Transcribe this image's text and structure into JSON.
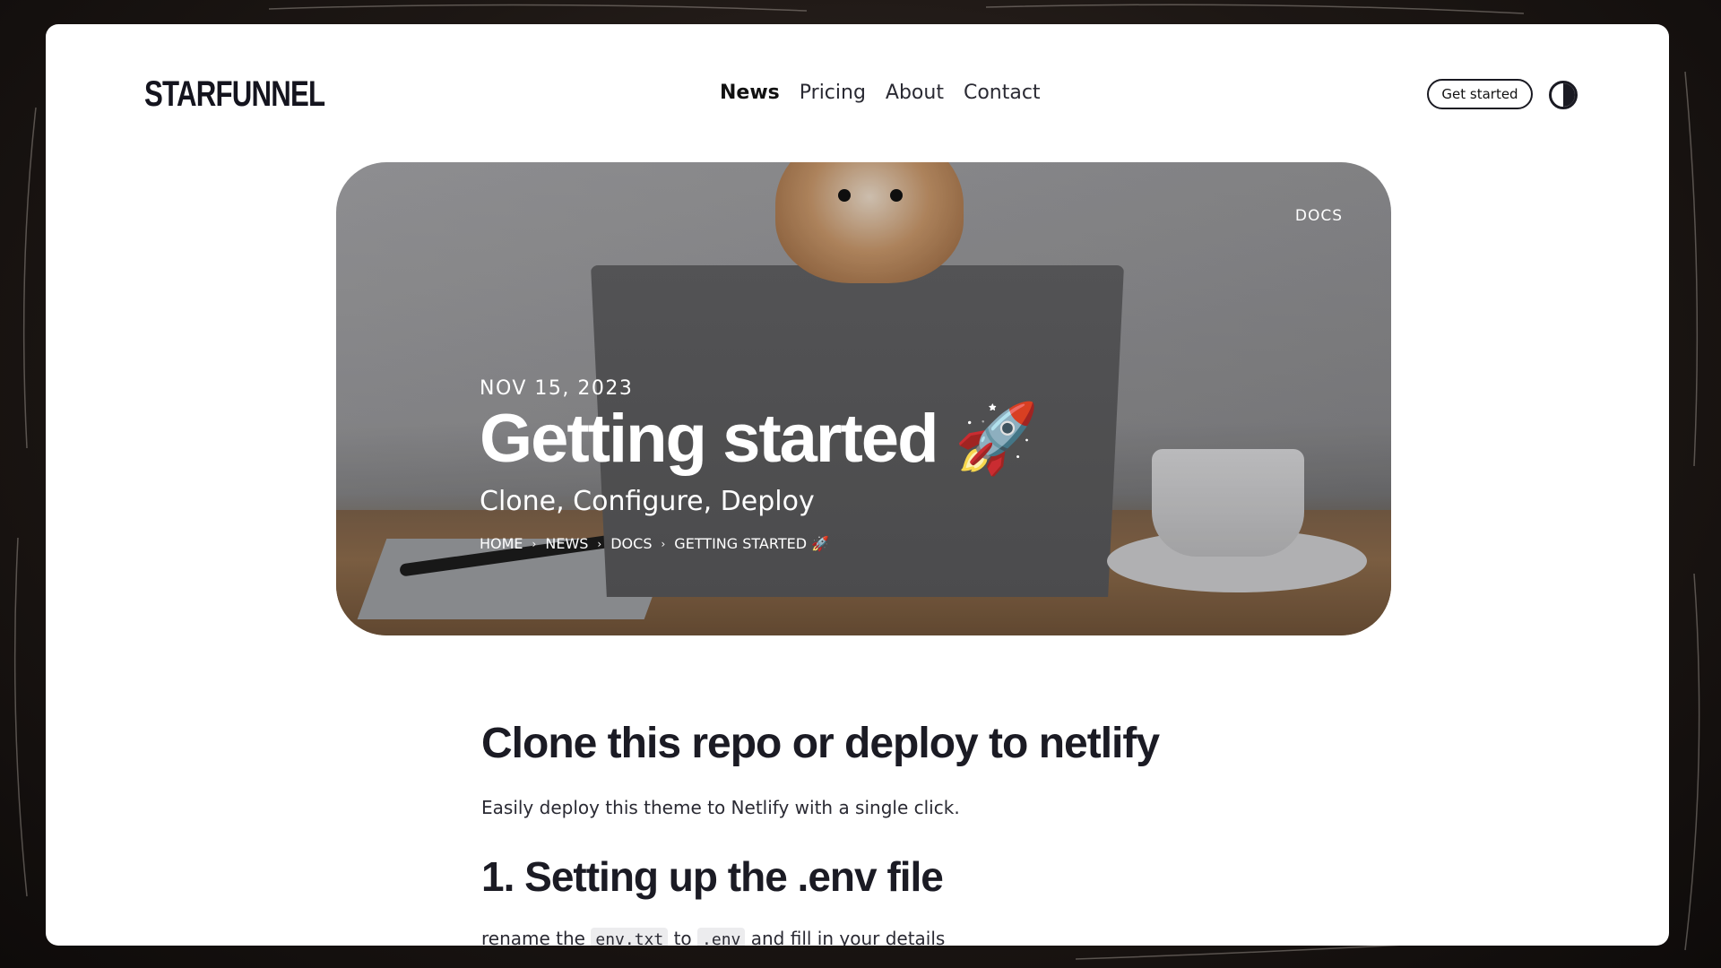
{
  "site": {
    "logo": "STARFUNNEL"
  },
  "nav": {
    "items": [
      "News",
      "Pricing",
      "About",
      "Contact"
    ],
    "active": "News"
  },
  "header": {
    "cta": "Get started",
    "theme_icon": "contrast-icon"
  },
  "hero": {
    "tag": "DOCS",
    "date": "NOV 15, 2023",
    "title": "Getting started 🚀",
    "subtitle": "Clone, Configure, Deploy",
    "breadcrumb": [
      "HOME",
      "NEWS",
      "DOCS",
      "GETTING STARTED 🚀"
    ]
  },
  "article": {
    "h2": "Clone this repo or deploy to netlify",
    "p1": "Easily deploy this theme to Netlify with a single click.",
    "h3": "1. Setting up the .env file",
    "p2_a": "rename the",
    "p2_code1": "env.txt",
    "p2_b": "to",
    "p2_code2": ".env",
    "p2_c": "and fill in your details"
  }
}
